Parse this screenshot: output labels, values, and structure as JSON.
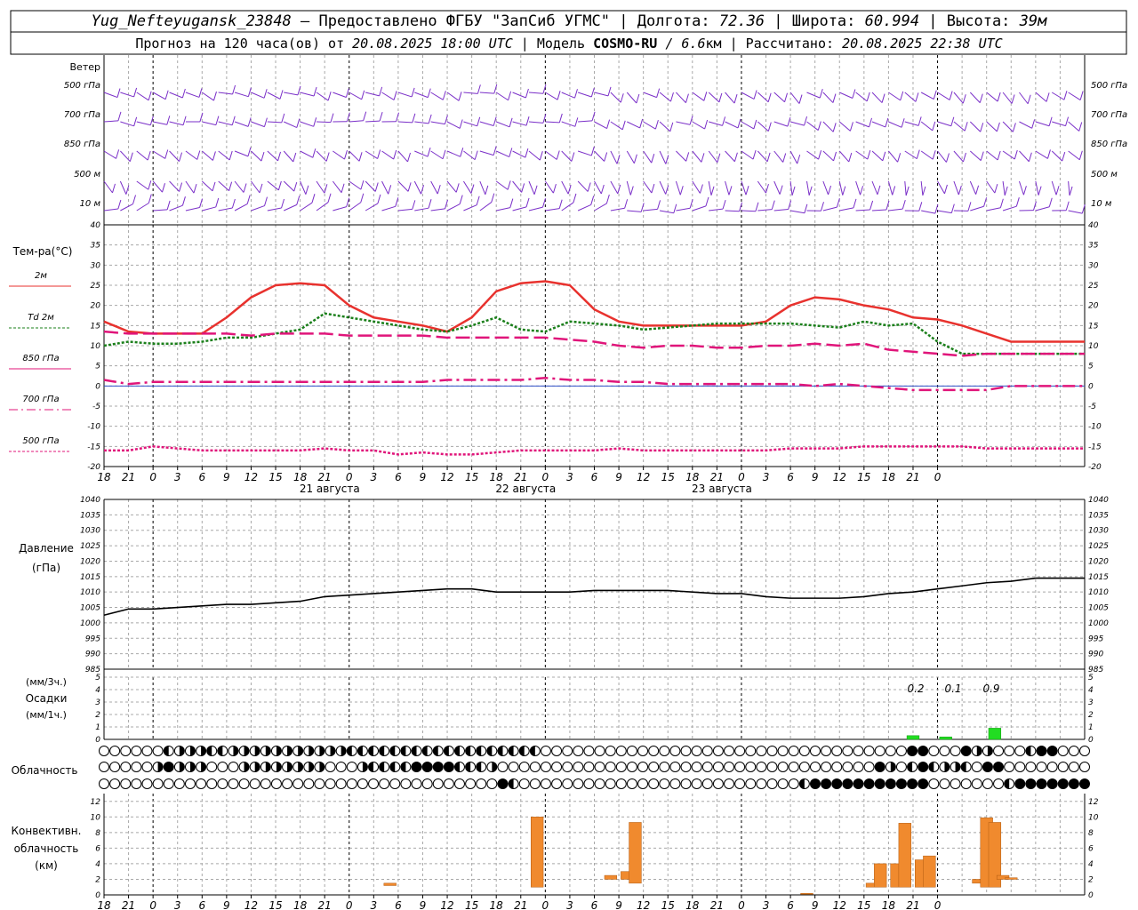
{
  "header": {
    "line1": {
      "station": "Yug_Nefteyugansk_23848",
      "provider": " – Предоставлено ФГБУ \"ЗапСиб УГМС\" | ",
      "lon_label": "Долгота: ",
      "lon": "72.36",
      "lat_label": " | Широта: ",
      "lat": "60.994",
      "alt_label": " | Высота: ",
      "alt": "39м"
    },
    "line2": {
      "prefix": "Прогноз на 120 часа(ов) от ",
      "init": "20.08.2025 18:00 UTC",
      "model_label": "  | Модель ",
      "model": "COSMO-RU",
      "res": " / 6.6",
      "res_unit": "км",
      "calc_label": " | Рассчитано: ",
      "calc": "20.08.2025 22:38 UTC"
    }
  },
  "time_axis": {
    "hour_labels": [
      "18",
      "21",
      "0",
      "3",
      "6",
      "9",
      "12",
      "15",
      "18",
      "21",
      "0",
      "3",
      "6",
      "9",
      "12",
      "15",
      "18",
      "21",
      "0",
      "3",
      "6",
      "9",
      "12",
      "15",
      "18",
      "21",
      "0",
      "3",
      "6",
      "9",
      "12",
      "15",
      "18",
      "21",
      "0"
    ],
    "day_labels": [
      "21 августа",
      "22 августа",
      "23 августа"
    ]
  },
  "wind_panel": {
    "title": "Ветер",
    "levels": [
      "500 гПа",
      "700 гПа",
      "850 гПа",
      "500  м",
      "10  м"
    ],
    "barb_color": "#7a2fc8"
  },
  "temp_panel": {
    "title": "Тем-ра(°C)",
    "legend": [
      {
        "label": "2м",
        "color": "#e8322e"
      },
      {
        "label": "Td  2м",
        "color": "#1a7f1a"
      },
      {
        "label": "850 гПа",
        "color": "#e0157a"
      },
      {
        "label": "700 гПа",
        "color": "#e0157a"
      },
      {
        "label": "500 гПа",
        "color": "#e0157a"
      }
    ]
  },
  "pressure_panel": {
    "title1": "Давление",
    "title2": "(гПа)"
  },
  "precip_panel": {
    "title1": "(мм/3ч.)",
    "title2": "Осадки",
    "title3": "(мм/1ч.)",
    "labels": [
      "0.2",
      "0.1",
      "0.9"
    ]
  },
  "cloud_panel": {
    "title": "Облачность"
  },
  "conv_panel": {
    "title1": "Конвективн.",
    "title2": "облачность",
    "title3": "(км)"
  },
  "chart_data": [
    {
      "type": "line",
      "name": "temperature",
      "x_hours": [
        0,
        3,
        6,
        9,
        12,
        15,
        18,
        21,
        24,
        27,
        30,
        33,
        36,
        39,
        42,
        45,
        48,
        51,
        54,
        57,
        60,
        63,
        66,
        69,
        72,
        75,
        78,
        81,
        84,
        87,
        90,
        93,
        96,
        99,
        102,
        105,
        108,
        111,
        114,
        117,
        120
      ],
      "ylim": [
        -20,
        40
      ],
      "yticks": [
        -20,
        -15,
        -10,
        -5,
        0,
        5,
        10,
        15,
        20,
        25,
        30,
        35,
        40
      ],
      "series": [
        {
          "name": "2м",
          "values": [
            16,
            13.5,
            13,
            13,
            13,
            17,
            22,
            25,
            25.5,
            25,
            20,
            17,
            16,
            15,
            13.5,
            17,
            23.5,
            25.5,
            26,
            25,
            19,
            16,
            15,
            15,
            15,
            15,
            15,
            16,
            20,
            22,
            21.5,
            20,
            19,
            17,
            16.5,
            15,
            13,
            11,
            11,
            11,
            11
          ]
        },
        {
          "name": "Td  2м",
          "values": [
            10,
            11,
            10.5,
            10.5,
            11,
            12,
            12,
            13,
            14,
            18,
            17,
            16,
            15,
            14,
            13.5,
            15,
            17,
            14,
            13.5,
            16,
            15.5,
            15,
            14,
            14.5,
            15,
            15.5,
            15.5,
            15.5,
            15.5,
            15,
            14.5,
            16,
            15,
            15.5,
            11,
            8,
            8,
            8,
            8,
            8,
            8
          ]
        },
        {
          "name": "850 гПа",
          "values": [
            13.5,
            13,
            13,
            13,
            13,
            13,
            12.5,
            13,
            13,
            13,
            12.5,
            12.5,
            12.5,
            12.5,
            12,
            12,
            12,
            12,
            12,
            11.5,
            11,
            10,
            9.5,
            10,
            10,
            9.5,
            9.5,
            10,
            10,
            10.5,
            10,
            10.5,
            9,
            8.5,
            8,
            7.5,
            8,
            8,
            8,
            8,
            8
          ]
        },
        {
          "name": "700 гПа",
          "values": [
            1.5,
            0.5,
            1,
            1,
            1,
            1,
            1,
            1,
            1,
            1,
            1,
            1,
            1,
            1,
            1.5,
            1.5,
            1.5,
            1.5,
            2,
            1.5,
            1.5,
            1,
            1,
            0.5,
            0.5,
            0.5,
            0.5,
            0.5,
            0.5,
            0,
            0.5,
            0,
            -0.5,
            -1,
            -1,
            -1,
            -1,
            0,
            0,
            0,
            0
          ]
        },
        {
          "name": "500 гПа",
          "values": [
            -16,
            -16,
            -15,
            -15.5,
            -16,
            -16,
            -16,
            -16,
            -16,
            -15.5,
            -16,
            -16,
            -17,
            -16.5,
            -17,
            -17,
            -16.5,
            -16,
            -16,
            -16,
            -16,
            -15.5,
            -16,
            -16,
            -16,
            -16,
            -16,
            -16,
            -15.5,
            -15.5,
            -15.5,
            -15,
            -15,
            -15,
            -15,
            -15,
            -15.5,
            -15.5,
            -15.5,
            -15.5,
            -15.5
          ]
        }
      ]
    },
    {
      "type": "line",
      "name": "pressure",
      "x_hours": [
        0,
        3,
        6,
        9,
        12,
        15,
        18,
        21,
        24,
        27,
        30,
        33,
        36,
        39,
        42,
        45,
        48,
        51,
        54,
        57,
        60,
        63,
        66,
        69,
        72,
        75,
        78,
        81,
        84,
        87,
        90,
        93,
        96,
        99,
        102,
        105,
        108,
        111,
        114,
        117,
        120
      ],
      "ylim": [
        985,
        1040
      ],
      "yticks": [
        985,
        990,
        995,
        1000,
        1005,
        1010,
        1015,
        1020,
        1025,
        1030,
        1035,
        1040
      ],
      "series": [
        {
          "name": "pressure",
          "values": [
            1002.5,
            1004.5,
            1004.5,
            1005,
            1005.5,
            1006,
            1006,
            1006.5,
            1007,
            1008.5,
            1009,
            1009.5,
            1010,
            1010.5,
            1011,
            1011,
            1010,
            1010,
            1010,
            1010,
            1010.5,
            1010.5,
            1010.5,
            1010.5,
            1010,
            1009.5,
            1009.5,
            1008.5,
            1008,
            1008,
            1008,
            1008.5,
            1009.5,
            1010,
            1011,
            1012,
            1013,
            1013.5,
            1014.5,
            1014.5,
            1014.5
          ]
        }
      ]
    },
    {
      "type": "bar",
      "name": "precipitation",
      "ylim": [
        0,
        5
      ],
      "bars": [
        {
          "hour": 99,
          "value": 0.3
        },
        {
          "hour": 103,
          "value": 0.2
        },
        {
          "hour": 109,
          "value": 0.9
        }
      ]
    },
    {
      "type": "bar",
      "name": "convective_cloud",
      "ylim": [
        0,
        13
      ],
      "yticks": [
        0,
        2,
        4,
        6,
        8,
        10,
        12
      ],
      "bars": [
        {
          "hour": 35,
          "bottom": 1.2,
          "top": 1.5
        },
        {
          "hour": 53,
          "bottom": 1,
          "top": 10
        },
        {
          "hour": 62,
          "bottom": 2,
          "top": 2.5
        },
        {
          "hour": 64,
          "bottom": 2,
          "top": 3
        },
        {
          "hour": 65,
          "bottom": 1.5,
          "top": 9.3
        },
        {
          "hour": 86,
          "bottom": 0,
          "top": 0.2
        },
        {
          "hour": 94,
          "bottom": 1,
          "top": 1.5
        },
        {
          "hour": 95,
          "bottom": 1,
          "top": 4
        },
        {
          "hour": 97,
          "bottom": 1,
          "top": 4
        },
        {
          "hour": 98,
          "bottom": 1,
          "top": 9.2
        },
        {
          "hour": 100,
          "bottom": 1,
          "top": 4.5
        },
        {
          "hour": 101,
          "bottom": 1,
          "top": 5
        },
        {
          "hour": 107,
          "bottom": 1.5,
          "top": 2
        },
        {
          "hour": 108,
          "bottom": 1,
          "top": 9.9
        },
        {
          "hour": 109,
          "bottom": 1,
          "top": 9.3
        },
        {
          "hour": 110,
          "bottom": 2,
          "top": 2.5
        },
        {
          "hour": 111,
          "bottom": 2,
          "top": 2.2
        }
      ]
    }
  ]
}
